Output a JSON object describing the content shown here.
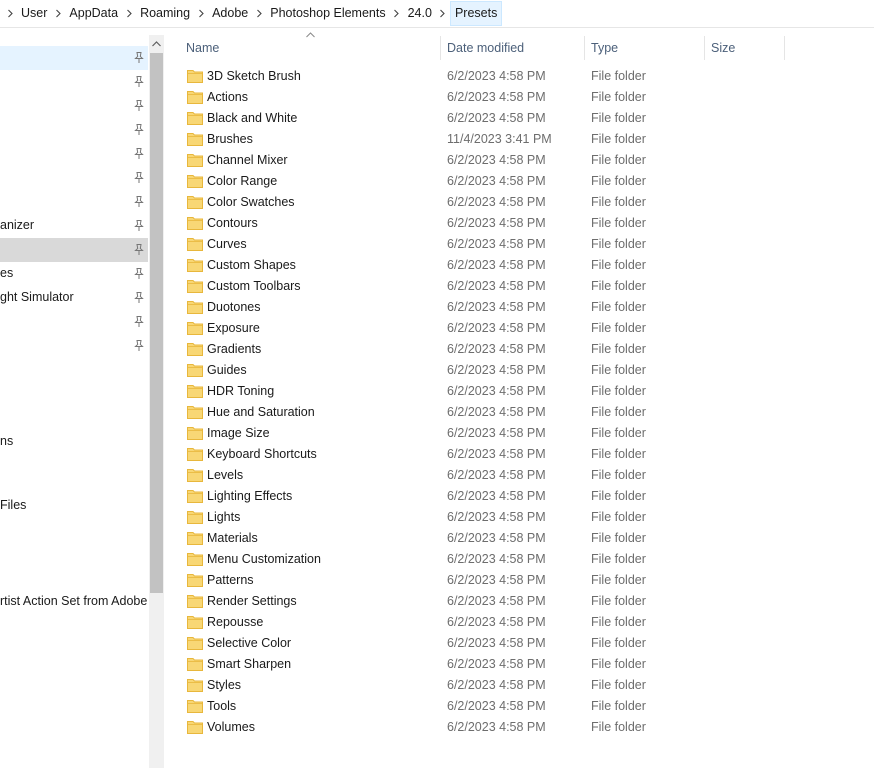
{
  "breadcrumb": {
    "items": [
      "User",
      "AppData",
      "Roaming",
      "Adobe",
      "Photoshop Elements",
      "24.0",
      "Presets"
    ]
  },
  "nav": {
    "items": [
      {
        "label": "",
        "pinned": true,
        "state": "selected"
      },
      {
        "label": "",
        "pinned": true,
        "state": ""
      },
      {
        "label": "",
        "pinned": true,
        "state": ""
      },
      {
        "label": "",
        "pinned": true,
        "state": ""
      },
      {
        "label": "",
        "pinned": true,
        "state": ""
      },
      {
        "label": "",
        "pinned": true,
        "state": ""
      },
      {
        "label": "",
        "pinned": true,
        "state": ""
      },
      {
        "label": "anizer",
        "pinned": true,
        "state": ""
      },
      {
        "label": "",
        "pinned": true,
        "state": "active"
      },
      {
        "label": "es",
        "pinned": true,
        "state": ""
      },
      {
        "label": "ght Simulator",
        "pinned": true,
        "state": ""
      },
      {
        "label": "",
        "pinned": true,
        "state": ""
      },
      {
        "label": "",
        "pinned": true,
        "state": ""
      },
      {
        "label": "",
        "pinned": false,
        "state": ""
      },
      {
        "label": "",
        "pinned": false,
        "state": ""
      },
      {
        "label": "",
        "pinned": false,
        "state": ""
      },
      {
        "label": "ns",
        "pinned": false,
        "state": ""
      },
      {
        "label": "",
        "pinned": false,
        "state": ""
      },
      {
        "label": " Files",
        "pinned": false,
        "state": ""
      },
      {
        "label": "",
        "pinned": false,
        "state": ""
      },
      {
        "label": "",
        "pinned": false,
        "state": ""
      },
      {
        "label": "rtist Action Set from Adobe C",
        "pinned": false,
        "state": ""
      }
    ]
  },
  "columns": {
    "name": "Name",
    "date_modified": "Date modified",
    "type": "Type",
    "size": "Size"
  },
  "files": [
    {
      "name": "3D Sketch Brush",
      "date": "6/2/2023 4:58 PM",
      "type": "File folder",
      "size": ""
    },
    {
      "name": "Actions",
      "date": "6/2/2023 4:58 PM",
      "type": "File folder",
      "size": ""
    },
    {
      "name": "Black and White",
      "date": "6/2/2023 4:58 PM",
      "type": "File folder",
      "size": ""
    },
    {
      "name": "Brushes",
      "date": "11/4/2023 3:41 PM",
      "type": "File folder",
      "size": ""
    },
    {
      "name": "Channel Mixer",
      "date": "6/2/2023 4:58 PM",
      "type": "File folder",
      "size": ""
    },
    {
      "name": "Color Range",
      "date": "6/2/2023 4:58 PM",
      "type": "File folder",
      "size": ""
    },
    {
      "name": "Color Swatches",
      "date": "6/2/2023 4:58 PM",
      "type": "File folder",
      "size": ""
    },
    {
      "name": "Contours",
      "date": "6/2/2023 4:58 PM",
      "type": "File folder",
      "size": ""
    },
    {
      "name": "Curves",
      "date": "6/2/2023 4:58 PM",
      "type": "File folder",
      "size": ""
    },
    {
      "name": "Custom Shapes",
      "date": "6/2/2023 4:58 PM",
      "type": "File folder",
      "size": ""
    },
    {
      "name": "Custom Toolbars",
      "date": "6/2/2023 4:58 PM",
      "type": "File folder",
      "size": ""
    },
    {
      "name": "Duotones",
      "date": "6/2/2023 4:58 PM",
      "type": "File folder",
      "size": ""
    },
    {
      "name": "Exposure",
      "date": "6/2/2023 4:58 PM",
      "type": "File folder",
      "size": ""
    },
    {
      "name": "Gradients",
      "date": "6/2/2023 4:58 PM",
      "type": "File folder",
      "size": ""
    },
    {
      "name": "Guides",
      "date": "6/2/2023 4:58 PM",
      "type": "File folder",
      "size": ""
    },
    {
      "name": "HDR Toning",
      "date": "6/2/2023 4:58 PM",
      "type": "File folder",
      "size": ""
    },
    {
      "name": "Hue and Saturation",
      "date": "6/2/2023 4:58 PM",
      "type": "File folder",
      "size": ""
    },
    {
      "name": "Image Size",
      "date": "6/2/2023 4:58 PM",
      "type": "File folder",
      "size": ""
    },
    {
      "name": "Keyboard Shortcuts",
      "date": "6/2/2023 4:58 PM",
      "type": "File folder",
      "size": ""
    },
    {
      "name": "Levels",
      "date": "6/2/2023 4:58 PM",
      "type": "File folder",
      "size": ""
    },
    {
      "name": "Lighting Effects",
      "date": "6/2/2023 4:58 PM",
      "type": "File folder",
      "size": ""
    },
    {
      "name": "Lights",
      "date": "6/2/2023 4:58 PM",
      "type": "File folder",
      "size": ""
    },
    {
      "name": "Materials",
      "date": "6/2/2023 4:58 PM",
      "type": "File folder",
      "size": ""
    },
    {
      "name": "Menu Customization",
      "date": "6/2/2023 4:58 PM",
      "type": "File folder",
      "size": ""
    },
    {
      "name": "Patterns",
      "date": "6/2/2023 4:58 PM",
      "type": "File folder",
      "size": ""
    },
    {
      "name": "Render Settings",
      "date": "6/2/2023 4:58 PM",
      "type": "File folder",
      "size": ""
    },
    {
      "name": "Repousse",
      "date": "6/2/2023 4:58 PM",
      "type": "File folder",
      "size": ""
    },
    {
      "name": "Selective Color",
      "date": "6/2/2023 4:58 PM",
      "type": "File folder",
      "size": ""
    },
    {
      "name": "Smart Sharpen",
      "date": "6/2/2023 4:58 PM",
      "type": "File folder",
      "size": ""
    },
    {
      "name": "Styles",
      "date": "6/2/2023 4:58 PM",
      "type": "File folder",
      "size": ""
    },
    {
      "name": "Tools",
      "date": "6/2/2023 4:58 PM",
      "type": "File folder",
      "size": ""
    },
    {
      "name": "Volumes",
      "date": "6/2/2023 4:58 PM",
      "type": "File folder",
      "size": ""
    }
  ],
  "colors": {
    "folder_fill": "#f8d775",
    "folder_tab": "#e8b73c",
    "header_text": "#4c607a",
    "secondary_text": "#6d6d6d",
    "selected_bg": "#e5f3ff",
    "active_bg": "#d9d9d9"
  }
}
